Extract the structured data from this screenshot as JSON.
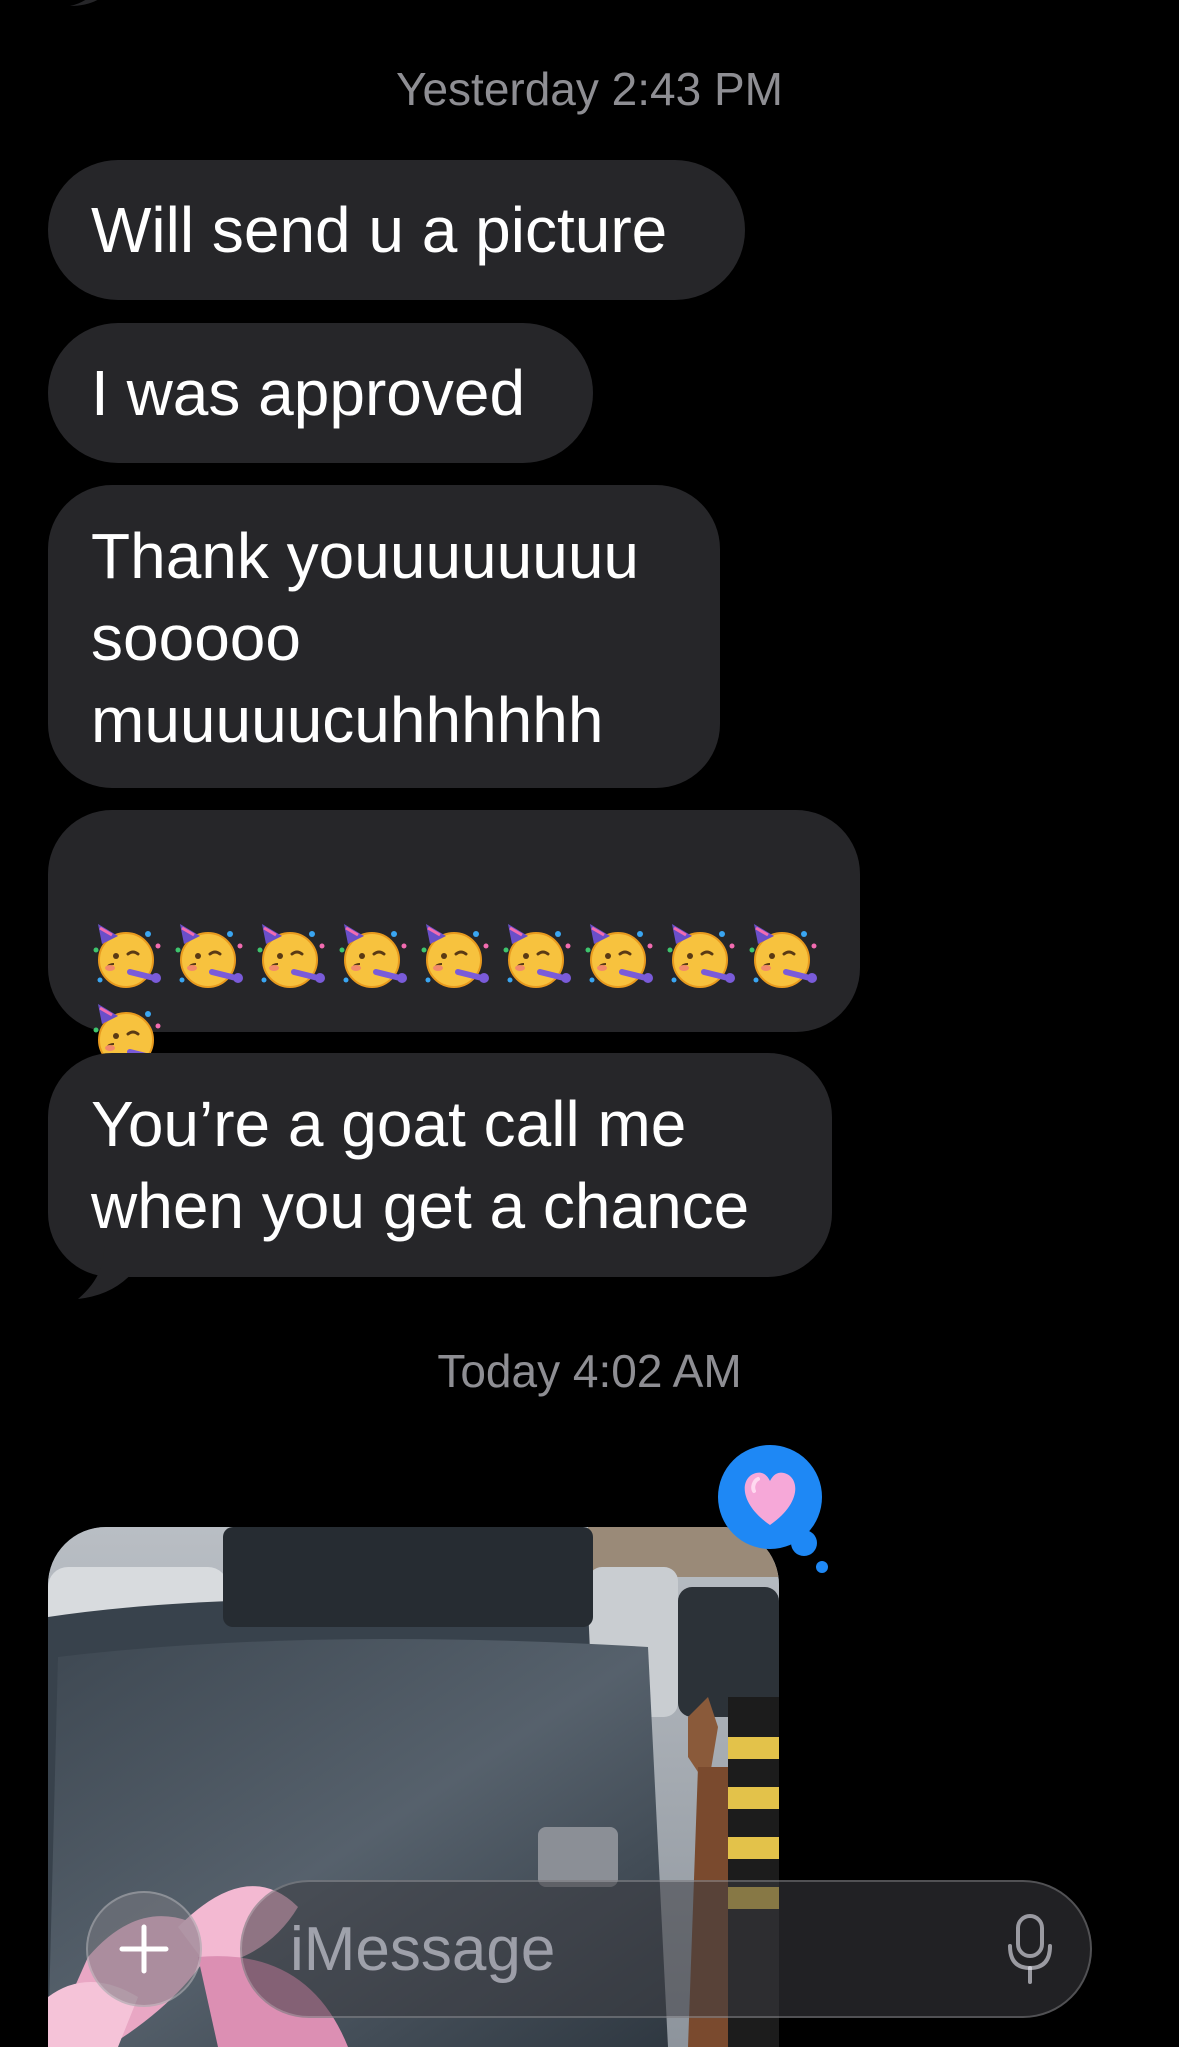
{
  "conversation": {
    "sections": [
      {
        "timestamp_day": "Yesterday",
        "timestamp_time": "2:43 PM",
        "messages": [
          {
            "text": "Will send u a picture"
          },
          {
            "text": "I was approved"
          },
          {
            "text": "Thank youuuuuuuu\nsooooo\nmuuuuucuhhhhhh"
          },
          {
            "emoji": "partying-face",
            "count": 10
          },
          {
            "text": "You’re a goat call me\nwhen you get a chance"
          }
        ]
      },
      {
        "timestamp_day": "Today",
        "timestamp_time": "4:02 AM",
        "messages": [
          {
            "attachment": "photo",
            "reaction": "pink-heart"
          }
        ]
      }
    ]
  },
  "compose": {
    "placeholder": "iMessage"
  },
  "colors": {
    "background": "#000000",
    "incoming_bubble": "#262629",
    "timestamp": "#8e8e93",
    "reaction_badge": "#1e88f5"
  },
  "icons": {
    "add": "plus-icon",
    "dictation": "microphone-icon",
    "reaction": "heart-icon"
  }
}
